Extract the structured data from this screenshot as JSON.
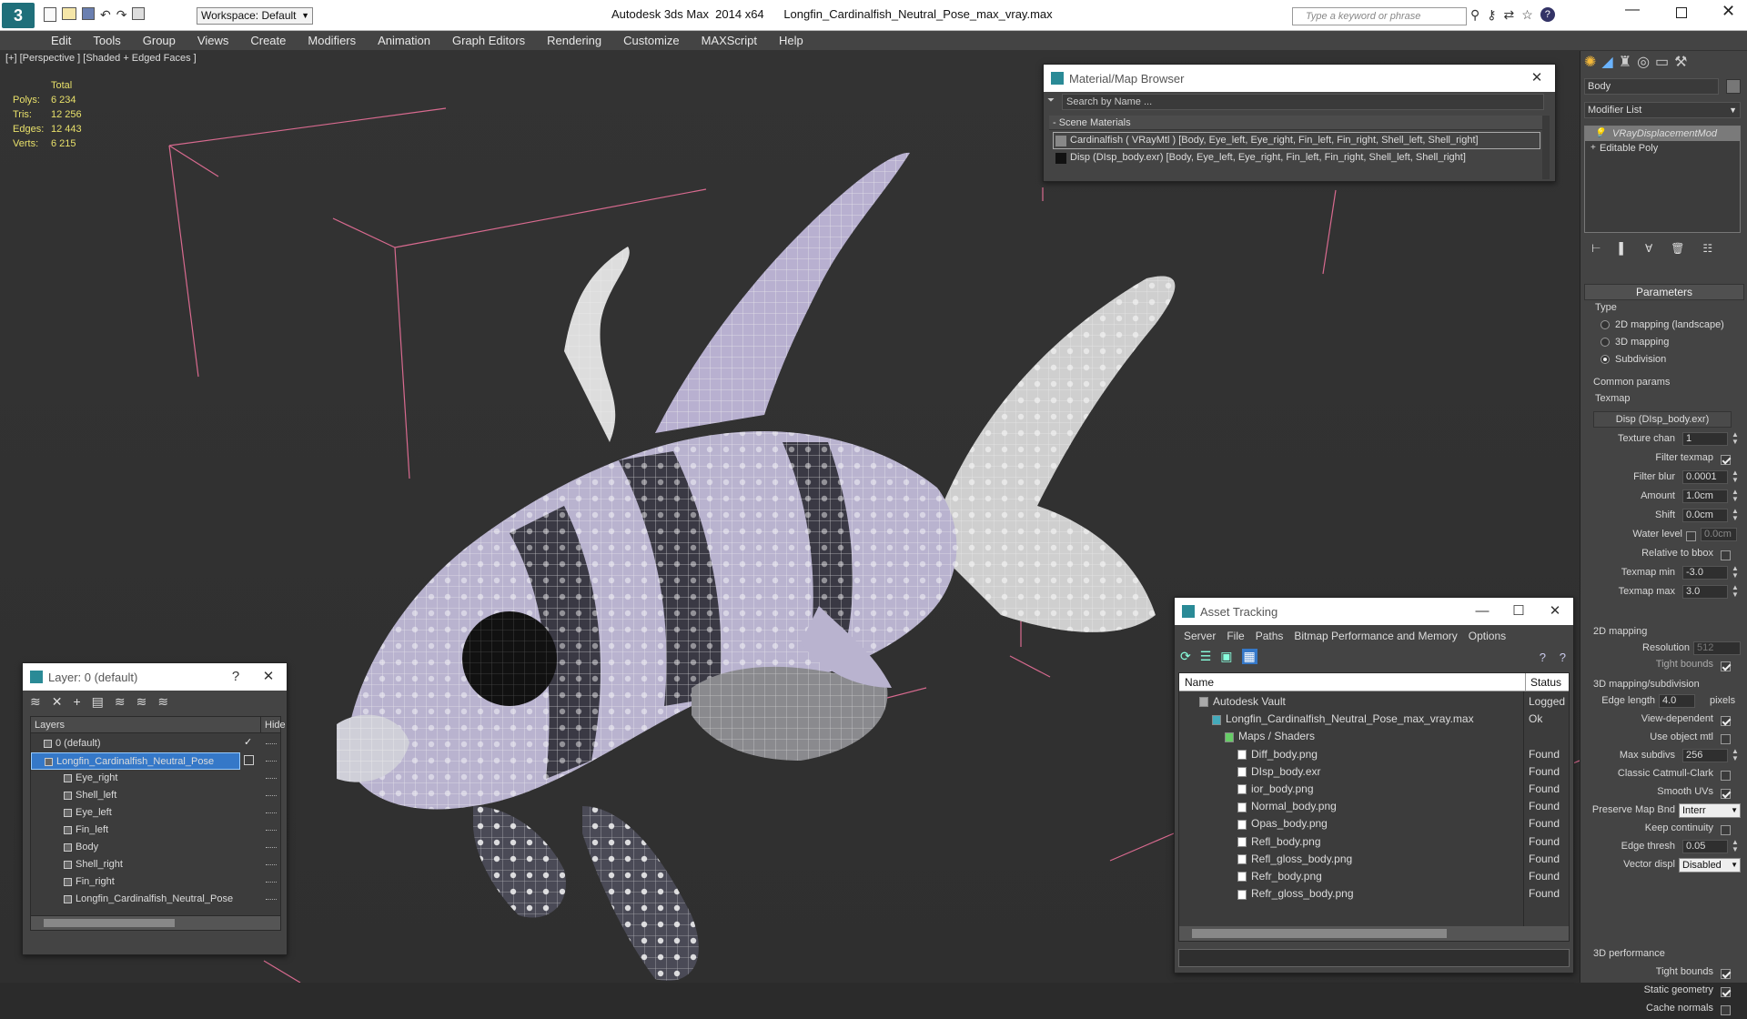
{
  "window": {
    "title": "Autodesk 3ds Max  2014 x64      Longfin_Cardinalfish_Neutral_Pose_max_vray.max",
    "workspace": "Workspace: Default",
    "search_placeholder": "Type a keyword or phrase"
  },
  "menu": [
    "Edit",
    "Tools",
    "Group",
    "Views",
    "Create",
    "Modifiers",
    "Animation",
    "Graph Editors",
    "Rendering",
    "Customize",
    "MAXScript",
    "Help"
  ],
  "viewport": {
    "label": "[+] [Perspective ] [Shaded + Edged Faces ]",
    "stats": {
      "header": "Total",
      "rows": [
        {
          "k": "Polys:",
          "v": "6 234"
        },
        {
          "k": "Tris:",
          "v": "12 256"
        },
        {
          "k": "Edges:",
          "v": "12 443"
        },
        {
          "k": "Verts:",
          "v": "6 215"
        }
      ]
    }
  },
  "material_browser": {
    "title": "Material/Map Browser",
    "search_placeholder": "Search by Name ...",
    "group": "- Scene Materials",
    "items": [
      "Cardinalfish  ( VRayMtl ) [Body, Eye_left, Eye_right, Fin_left, Fin_right, Shell_left, Shell_right]",
      "Disp (DIsp_body.exr) [Body, Eye_left, Eye_right, Fin_left, Fin_right, Shell_left, Shell_right]"
    ]
  },
  "layer_panel": {
    "title": "Layer: 0 (default)",
    "help": "?",
    "col_layers": "Layers",
    "col_hide": "Hide",
    "rows": [
      {
        "label": "0 (default)",
        "indent": 1,
        "selected": false,
        "check": true
      },
      {
        "label": "Longfin_Cardinalfish_Neutral_Pose",
        "indent": 1,
        "selected": true,
        "check": false
      },
      {
        "label": "Eye_right",
        "indent": 2
      },
      {
        "label": "Shell_left",
        "indent": 2
      },
      {
        "label": "Eye_left",
        "indent": 2
      },
      {
        "label": "Fin_left",
        "indent": 2
      },
      {
        "label": "Body",
        "indent": 2
      },
      {
        "label": "Shell_right",
        "indent": 2
      },
      {
        "label": "Fin_right",
        "indent": 2
      },
      {
        "label": "Longfin_Cardinalfish_Neutral_Pose",
        "indent": 2
      }
    ]
  },
  "asset_tracking": {
    "title": "Asset Tracking",
    "menu": [
      "Server",
      "File",
      "Paths",
      "Bitmap Performance and Memory",
      "Options"
    ],
    "col_name": "Name",
    "col_status": "Status",
    "rows": [
      {
        "name": "Autodesk Vault",
        "status": "Logged O",
        "indent": 1,
        "icon": "vault"
      },
      {
        "name": "Longfin_Cardinalfish_Neutral_Pose_max_vray.max",
        "status": "Ok",
        "indent": 2,
        "icon": "max"
      },
      {
        "name": "Maps / Shaders",
        "status": "",
        "indent": 3,
        "icon": "maps"
      },
      {
        "name": "Diff_body.png",
        "status": "Found",
        "indent": 4,
        "icon": "png"
      },
      {
        "name": "DIsp_body.exr",
        "status": "Found",
        "indent": 4,
        "icon": "exr"
      },
      {
        "name": "ior_body.png",
        "status": "Found",
        "indent": 4,
        "icon": "png"
      },
      {
        "name": "Normal_body.png",
        "status": "Found",
        "indent": 4,
        "icon": "png"
      },
      {
        "name": "Opas_body.png",
        "status": "Found",
        "indent": 4,
        "icon": "png"
      },
      {
        "name": "Refl_body.png",
        "status": "Found",
        "indent": 4,
        "icon": "png"
      },
      {
        "name": "Refl_gloss_body.png",
        "status": "Found",
        "indent": 4,
        "icon": "png"
      },
      {
        "name": "Refr_body.png",
        "status": "Found",
        "indent": 4,
        "icon": "png"
      },
      {
        "name": "Refr_gloss_body.png",
        "status": "Found",
        "indent": 4,
        "icon": "png"
      }
    ]
  },
  "command_panel": {
    "object_name": "Body",
    "modifier_list": "Modifier List",
    "stack": [
      "VRayDisplacementMod",
      "Editable Poly"
    ],
    "parameters": "Parameters",
    "type_label": "Type",
    "types": [
      {
        "label": "2D mapping (landscape)",
        "on": false
      },
      {
        "label": "3D mapping",
        "on": false
      },
      {
        "label": "Subdivision",
        "on": true
      }
    ],
    "common_params": "Common params",
    "texmap": "Texmap",
    "texmap_value": "Disp (DIsp_body.exr)",
    "fields": [
      {
        "label": "Texture chan",
        "value": "1"
      },
      {
        "label": "Filter texmap",
        "check": true
      },
      {
        "label": "Filter blur",
        "value": "0.0001"
      },
      {
        "label": "Amount",
        "value": "1.0cm"
      },
      {
        "label": "Shift",
        "value": "0.0cm"
      },
      {
        "label": "Water level",
        "value": "0.0cm",
        "check": false
      },
      {
        "label": "Relative to bbox",
        "check": false
      },
      {
        "label": "Texmap min",
        "value": "-3.0"
      },
      {
        "label": "Texmap max",
        "value": "3.0"
      }
    ],
    "mapping2d": "2D mapping",
    "resolution": {
      "label": "Resolution",
      "value": "512"
    },
    "tight_bounds": {
      "label": "Tight bounds",
      "check": true
    },
    "mapping3d": "3D mapping/subdivision",
    "edge_length": {
      "label": "Edge length",
      "value": "4.0",
      "unit": "pixels"
    },
    "fields3d": [
      {
        "label": "View-dependent",
        "check": true
      },
      {
        "label": "Use object mtl",
        "check": false
      },
      {
        "label": "Max subdivs",
        "value": "256"
      },
      {
        "label": "Classic Catmull-Clark",
        "check": false
      },
      {
        "label": "Smooth UVs",
        "check": true
      },
      {
        "label": "Preserve Map Bnd",
        "select": "Interr"
      },
      {
        "label": "Keep continuity",
        "check": false
      },
      {
        "label": "Edge thresh",
        "value": "0.05"
      },
      {
        "label": "Vector displ",
        "select": "Disabled"
      }
    ],
    "performance": "3D performance",
    "perf": [
      {
        "label": "Tight bounds",
        "check": true
      },
      {
        "label": "Static geometry",
        "check": true
      },
      {
        "label": "Cache normals",
        "check": false
      }
    ]
  }
}
